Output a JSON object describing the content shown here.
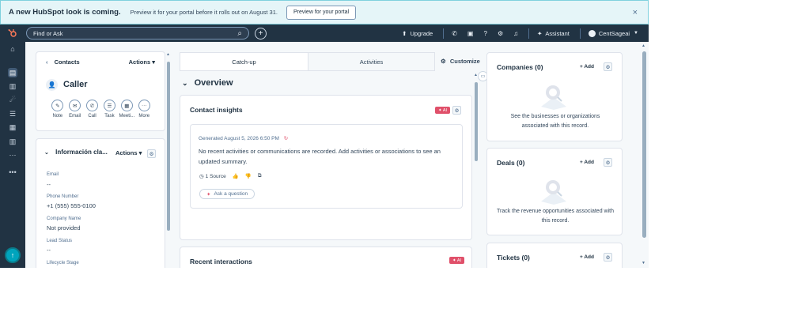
{
  "banner": {
    "title": "A new HubSpot look is coming.",
    "text": "Preview it for your portal before it rolls out on August 31.",
    "button": "Preview for your portal",
    "close": "×"
  },
  "topnav": {
    "logo": "⚙",
    "search_placeholder": "Find or Ask",
    "search_icon": "⌕",
    "plus": "+",
    "upgrade": "Upgrade",
    "assistant": "Assistant",
    "account": "CentSageai",
    "icons": [
      "phone-icon",
      "marketplace-icon",
      "help-icon",
      "settings-icon",
      "notifications-icon"
    ]
  },
  "left": {
    "back_label": "Contacts",
    "actions_label": "Actions ▾",
    "contact_name": "Caller",
    "activities": [
      {
        "label": "Note",
        "icon": "✎"
      },
      {
        "label": "Email",
        "icon": "✉"
      },
      {
        "label": "Call",
        "icon": "✆"
      },
      {
        "label": "Task",
        "icon": "☰"
      },
      {
        "label": "Meeti...",
        "icon": "▦"
      },
      {
        "label": "More",
        "icon": "···"
      }
    ],
    "info_title": "Información cla...",
    "info_actions": "Actions ▾",
    "fields": [
      {
        "label": "Email",
        "value": "--"
      },
      {
        "label": "Phone Number",
        "value": "+1 (555) 555-0100"
      },
      {
        "label": "Company Name",
        "value": "Not provided"
      },
      {
        "label": "Lead Status",
        "value": "--"
      },
      {
        "label": "Lifecycle Stage",
        "value": ""
      }
    ]
  },
  "middle": {
    "tabs": [
      "Catch-up",
      "Activities"
    ],
    "customize": "Customize",
    "overview": "Overview",
    "insights_title": "Contact insights",
    "ai_badge": "✦ AI",
    "generated": "Generated August 5, 2026 6:50 PM",
    "summary": "No recent activities or communications are recorded. Add activities or associations to see an updated summary.",
    "source": "1 Source",
    "ask": "Ask a question",
    "recent_title": "Recent interactions",
    "recent_badge": "✦ AI"
  },
  "right": {
    "cards": [
      {
        "title": "Companies (0)",
        "add": "+ Add",
        "desc": "See the businesses or organizations associated with this record."
      },
      {
        "title": "Deals (0)",
        "add": "+ Add",
        "desc": "Track the revenue opportunities associated with this record."
      },
      {
        "title": "Tickets (0)",
        "add": "+ Add",
        "desc": ""
      }
    ]
  },
  "colors": {
    "nav_bg": "#213343",
    "banner_bg": "#e5f5f8",
    "ai_badge": "#e0506a",
    "help_button": "#00a4bd"
  }
}
